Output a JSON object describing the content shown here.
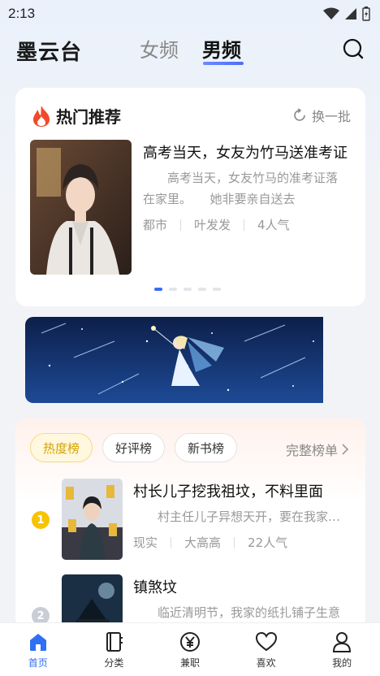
{
  "status": {
    "time": "2:13"
  },
  "header": {
    "app_name": "墨云台",
    "tabs": [
      {
        "label": "女频",
        "active": false
      },
      {
        "label": "男频",
        "active": true
      }
    ],
    "search_icon": "search-icon"
  },
  "hot": {
    "title": "热门推荐",
    "refresh_label": "换一批",
    "book": {
      "title": "高考当天，女友为竹马送准考证",
      "desc": "高考当天，女友竹马的准考证落在家里。　　她非要亲自送去",
      "genre": "都市",
      "author": "叶发发",
      "popularity": "4人气"
    },
    "carousel_pages": 5,
    "carousel_active": 0
  },
  "ranking": {
    "tabs": [
      {
        "label": "热度榜",
        "active": true
      },
      {
        "label": "好评榜",
        "active": false
      },
      {
        "label": "新书榜",
        "active": false
      }
    ],
    "full_list_label": "完整榜单",
    "items": [
      {
        "rank": "1",
        "title": "村长儿子挖我祖坟，不料里面",
        "desc": "村主任儿子异想天开，要在我家祖坟",
        "genre": "现实",
        "author": "大高高",
        "popularity": "22人气"
      },
      {
        "rank": "2",
        "title": "镇煞坟",
        "desc": "临近清明节，我家的纸扎铺子生意"
      }
    ]
  },
  "nav": {
    "items": [
      {
        "label": "首页",
        "icon": "home-icon",
        "active": true
      },
      {
        "label": "分类",
        "icon": "book-icon",
        "active": false
      },
      {
        "label": "兼职",
        "icon": "yen-icon",
        "active": false
      },
      {
        "label": "喜欢",
        "icon": "heart-icon",
        "active": false
      },
      {
        "label": "我的",
        "icon": "user-icon",
        "active": false
      }
    ]
  },
  "colors": {
    "accent": "#2f6ff2",
    "rank1": "#f7c400",
    "rank2": "#c8cdd6",
    "hot_fire": "#f04a2a"
  }
}
